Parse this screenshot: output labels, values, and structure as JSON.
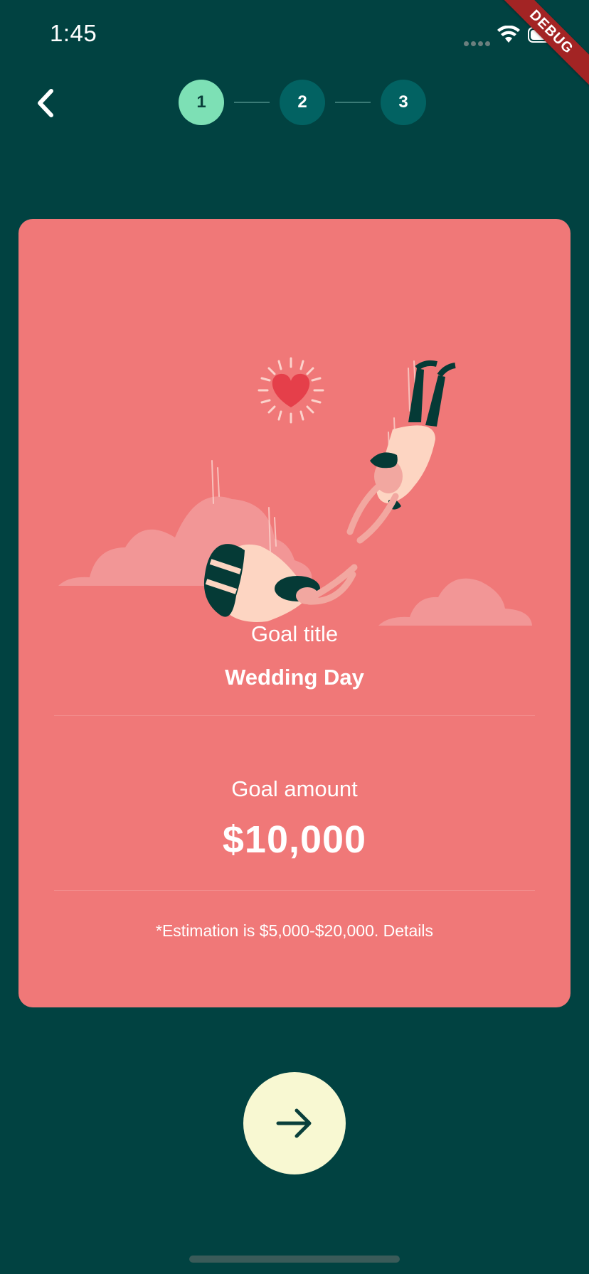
{
  "status_bar": {
    "time": "1:45",
    "icons": [
      "cellular-signal-icon",
      "wifi-icon",
      "battery-icon"
    ]
  },
  "debug_banner": "DEBUG",
  "header": {
    "back_icon": "chevron-left-icon",
    "steps": [
      {
        "label": "1",
        "state": "active"
      },
      {
        "label": "2",
        "state": "inactive"
      },
      {
        "label": "3",
        "state": "inactive"
      }
    ]
  },
  "card": {
    "background": "#f07878",
    "illustration": "couple-skydiving-heart-illustration",
    "goal_title_label": "Goal title",
    "goal_title_value": "Wedding Day",
    "goal_amount_label": "Goal amount",
    "goal_amount_value": "$10,000",
    "estimation_note": "*Estimation is $5,000-$20,000. Details"
  },
  "next_button": {
    "icon": "arrow-right-icon"
  },
  "colors": {
    "background": "#014241",
    "step_active": "#7de0b5",
    "step_inactive": "#026262",
    "card": "#f07878",
    "next_button": "#f8f8d2"
  }
}
